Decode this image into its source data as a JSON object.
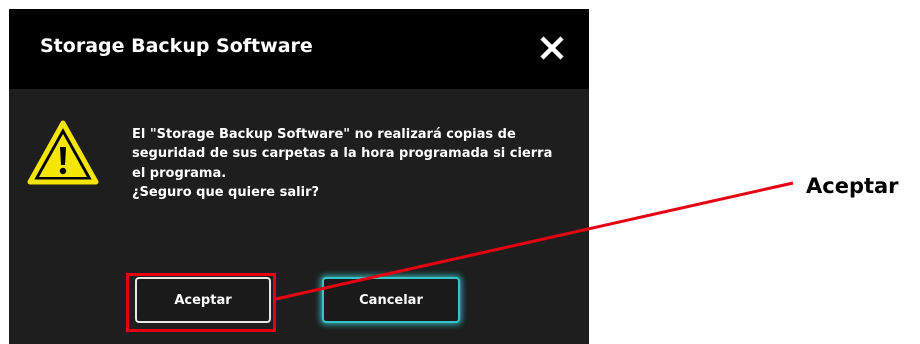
{
  "dialog": {
    "title": "Storage Backup Software",
    "close_icon": "close-icon",
    "warning_icon": "warning-triangle-icon",
    "message_lines": [
      "El \"Storage Backup Software\" no realizará copias de",
      "seguridad de sus carpetas a la hora programada si cierra",
      "el programa.",
      "¿Seguro que quiere salir?"
    ],
    "accept_label": "Aceptar",
    "cancel_label": "Cancelar"
  },
  "callout": {
    "label": "Aceptar",
    "color": "#e60012"
  },
  "colors": {
    "titlebar": "#000000",
    "dialog_body": "#1e1e1e",
    "warning_yellow": "#f5e600",
    "cancel_glow": "#36c6c8",
    "highlight_red": "#e60012"
  }
}
